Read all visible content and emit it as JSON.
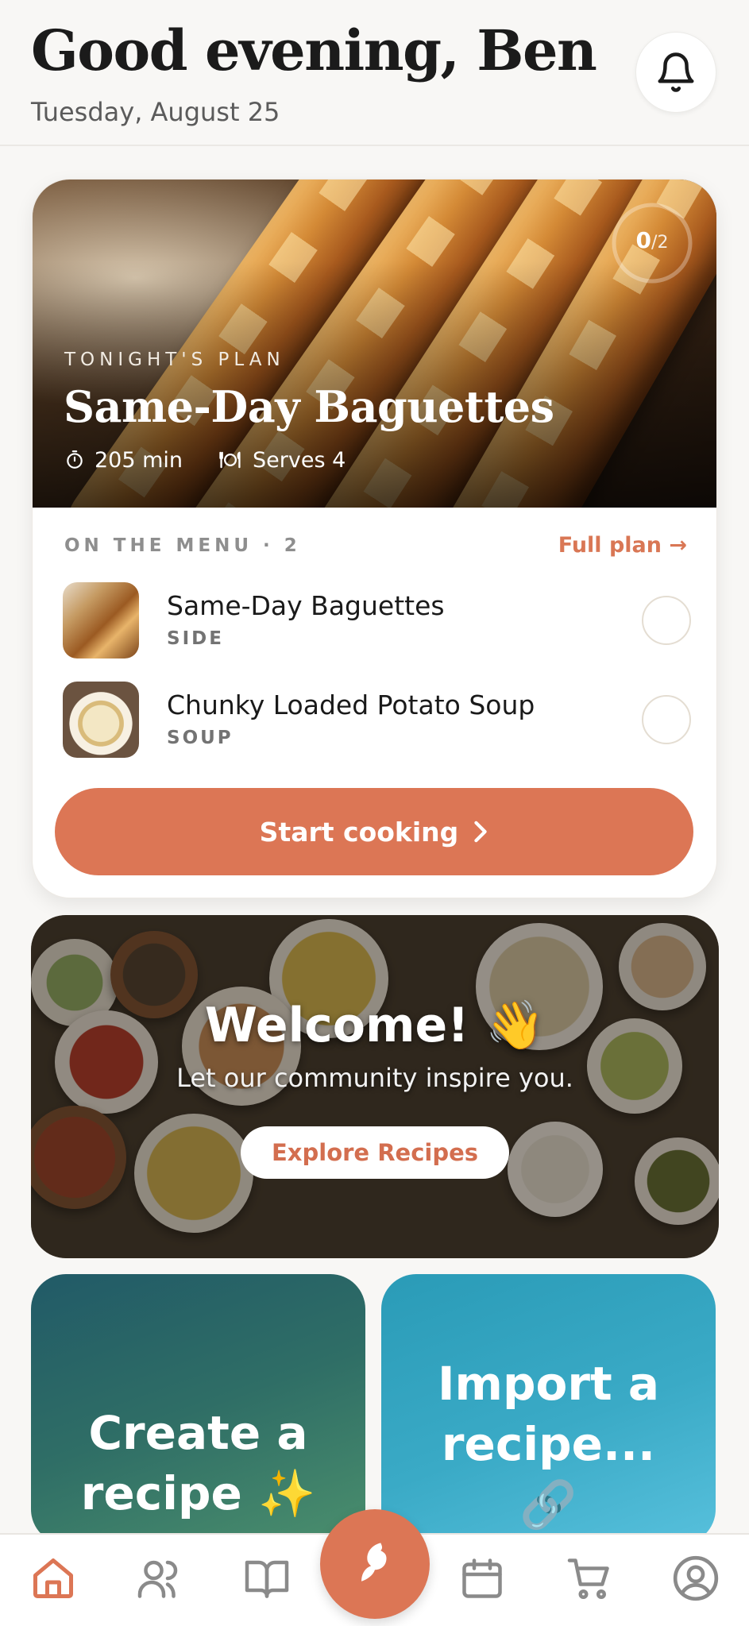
{
  "header": {
    "greeting": "Good evening, Ben",
    "date": "Tuesday, August 25",
    "notifications_icon": "bell-icon"
  },
  "plan_card": {
    "progress": {
      "done": "0",
      "total": "/2"
    },
    "eyebrow": "TONIGHT'S PLAN",
    "title": "Same-Day Baguettes",
    "time": "205 min",
    "serves": "Serves 4",
    "menu_label": "ON THE MENU · 2",
    "full_plan_label": "Full plan →",
    "items": [
      {
        "name": "Same-Day Baguettes",
        "category": "SIDE"
      },
      {
        "name": "Chunky Loaded Potato Soup",
        "category": "SOUP"
      }
    ],
    "start_label": "Start cooking"
  },
  "welcome": {
    "title": "Welcome! 👋",
    "subtitle": "Let our community inspire you.",
    "button_label": "Explore Recipes"
  },
  "tiles": {
    "create_line1": "Create a",
    "create_line2": "recipe ✨",
    "import_line1": "Import a",
    "import_line2": "recipe...",
    "import_line3": "🔗"
  },
  "nav": {
    "items": [
      "home-icon",
      "community-icon",
      "recipe-book-icon",
      "cook-fab-icon",
      "calendar-icon",
      "cart-icon",
      "profile-icon"
    ]
  },
  "colors": {
    "accent": "#dc7655",
    "background": "#f8f7f5",
    "tile_create": "#2f6e66",
    "tile_import": "#3aaac6"
  }
}
